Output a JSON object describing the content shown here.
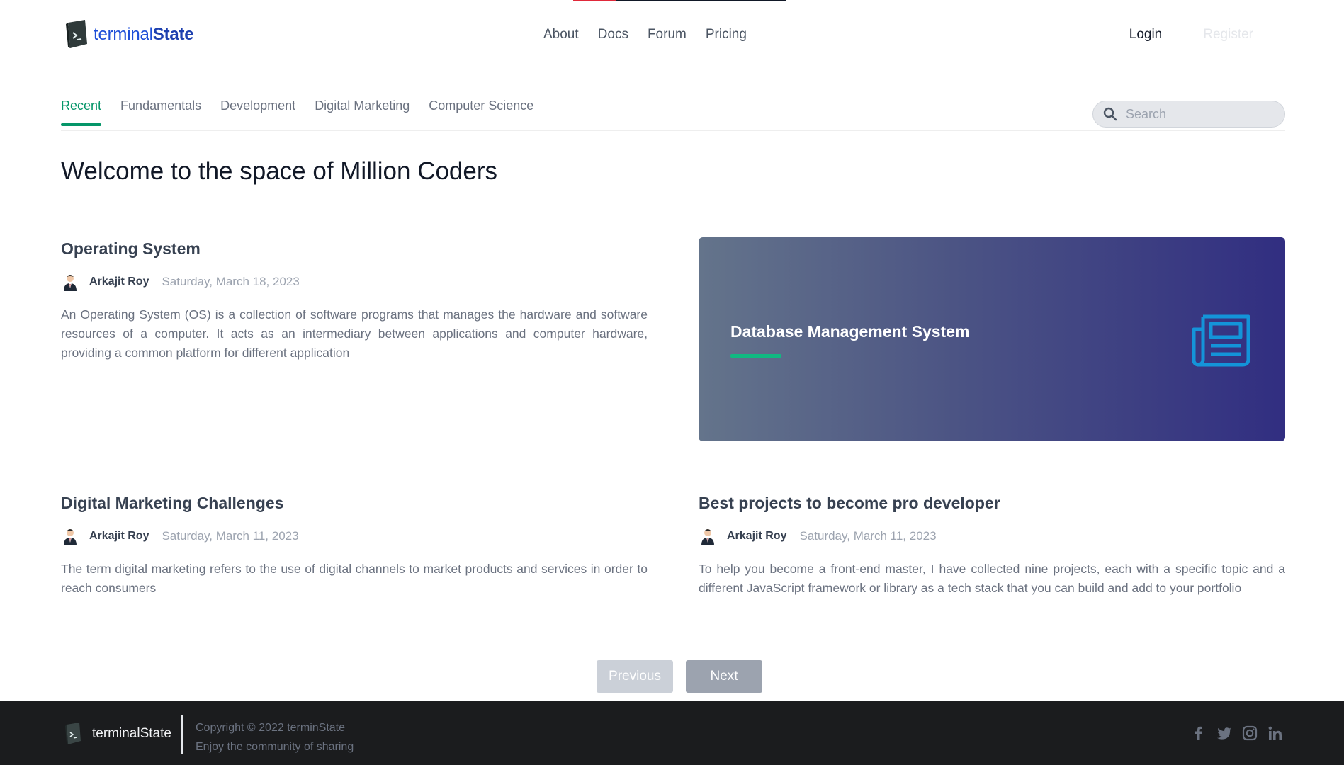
{
  "brand": {
    "name_prefix": "terminal",
    "name_suffix": "State"
  },
  "nav": {
    "links": [
      "About",
      "Docs",
      "Forum",
      "Pricing"
    ],
    "login": "Login",
    "register": "Register"
  },
  "tabs": [
    "Recent",
    "Fundamentals",
    "Development",
    "Digital Marketing",
    "Computer Science"
  ],
  "search": {
    "placeholder": "Search"
  },
  "welcome": "Welcome to the space of Million Coders",
  "posts": [
    {
      "title": "Operating System",
      "author": "Arkajit Roy",
      "date": "Saturday, March 18, 2023",
      "excerpt": "An Operating System (OS) is a collection of software programs that manages the hardware and software resources of a computer. It acts as an intermediary between applications and computer hardware, providing a common platform for different application"
    },
    {
      "title": "Digital Marketing Challenges",
      "author": "Arkajit Roy",
      "date": "Saturday, March 11, 2023",
      "excerpt": "The term digital marketing refers to the use of digital channels to market products and services in order to reach consumers"
    },
    {
      "title": "Best projects to become pro developer",
      "author": "Arkajit Roy",
      "date": "Saturday, March 11, 2023",
      "excerpt": "To help you become a front-end master, I have collected nine projects, each with a specific topic and a different JavaScript framework or library as a tech stack that you can build and add to your portfolio"
    }
  ],
  "feature": {
    "title": "Database Management System",
    "icon": "newspaper-icon"
  },
  "pager": {
    "previous": "Previous",
    "next": "Next"
  },
  "footer": {
    "brand": "terminalState",
    "copyright": "Copyright © 2022 terminState",
    "tagline": "Enjoy the community of sharing",
    "socials": [
      "facebook-icon",
      "twitter-icon",
      "instagram-icon",
      "linkedin-icon"
    ]
  },
  "colors": {
    "accent": "#059669",
    "brand_blue": "#1d4ed8",
    "footer_bg": "#1b1c1e",
    "feature_gradient_start": "#64748b",
    "feature_gradient_end": "#312e81"
  }
}
